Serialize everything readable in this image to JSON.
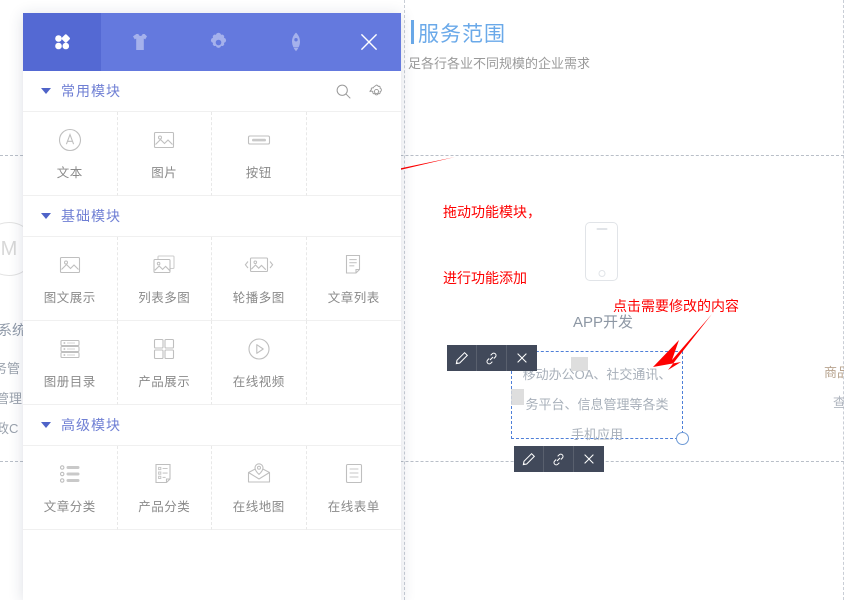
{
  "canvas": {
    "site_title": "服务范围",
    "site_subtitle": "足各行各业不同规模的企业需求",
    "ghost_left": {
      "circle_letter": "M",
      "line1": "系统",
      "line2": "务管",
      "line3": "管理",
      "line4": "政C"
    },
    "ghost_right": {
      "line1": "商品",
      "line2": "查"
    },
    "phone_module": {
      "label": "APP开发",
      "icon": "phone-icon"
    },
    "selected_module": {
      "text_line1": "移动办公OA、社交通讯、",
      "text_line2": "务平台、信息管理等各类",
      "text_line3": "手机应用"
    },
    "mini_toolbar": {
      "edit_label": "编辑",
      "link_label": "链接",
      "delete_label": "删除",
      "icons": [
        "pencil-icon",
        "link-icon",
        "close-icon"
      ]
    },
    "annotations": [
      {
        "id": "drag",
        "line1": "拖动功能模块，",
        "line2": "进行功能添加",
        "color": "#fe0000"
      },
      {
        "id": "click",
        "line1": "点击需要修改的内容",
        "color": "#fe0000"
      }
    ]
  },
  "module_panel": {
    "header_tabs": [
      {
        "name": "modules",
        "icon": "grid-icon",
        "active": true
      },
      {
        "name": "styles",
        "icon": "shirt-icon",
        "active": false
      },
      {
        "name": "settings",
        "icon": "gear-icon",
        "active": false
      },
      {
        "name": "publish",
        "icon": "rocket-icon",
        "active": false
      }
    ],
    "close_label": "×",
    "sections": [
      {
        "title": "常用模块",
        "has_actions": true,
        "search_icon": "search-icon",
        "settings_icon": "gear-icon",
        "items": [
          {
            "label": "文本",
            "icon": "text-icon"
          },
          {
            "label": "图片",
            "icon": "image-icon"
          },
          {
            "label": "按钮",
            "icon": "button-icon"
          }
        ]
      },
      {
        "title": "基础模块",
        "has_actions": false,
        "items": [
          {
            "label": "图文展示",
            "icon": "image-icon"
          },
          {
            "label": "列表多图",
            "icon": "multi-image-icon"
          },
          {
            "label": "轮播多图",
            "icon": "carousel-icon"
          },
          {
            "label": "文章列表",
            "icon": "article-list-icon"
          },
          {
            "label": "图册目录",
            "icon": "album-catalog-icon"
          },
          {
            "label": "产品展示",
            "icon": "product-grid-icon"
          },
          {
            "label": "在线视频",
            "icon": "video-icon"
          }
        ]
      },
      {
        "title": "高级模块",
        "has_actions": false,
        "items": [
          {
            "label": "文章分类",
            "icon": "article-category-icon"
          },
          {
            "label": "产品分类",
            "icon": "product-category-icon"
          },
          {
            "label": "在线地图",
            "icon": "map-icon"
          },
          {
            "label": "在线表单",
            "icon": "form-icon"
          }
        ]
      }
    ]
  },
  "colors": {
    "panel_header": "#6479de",
    "panel_header_active": "#5469d3",
    "section_title": "#6f7fd4",
    "annotation_red": "#fe0000",
    "selection_blue": "#4f7fd8",
    "toolbar_dark": "#41495a",
    "site_title_blue": "#6aa9e9"
  }
}
